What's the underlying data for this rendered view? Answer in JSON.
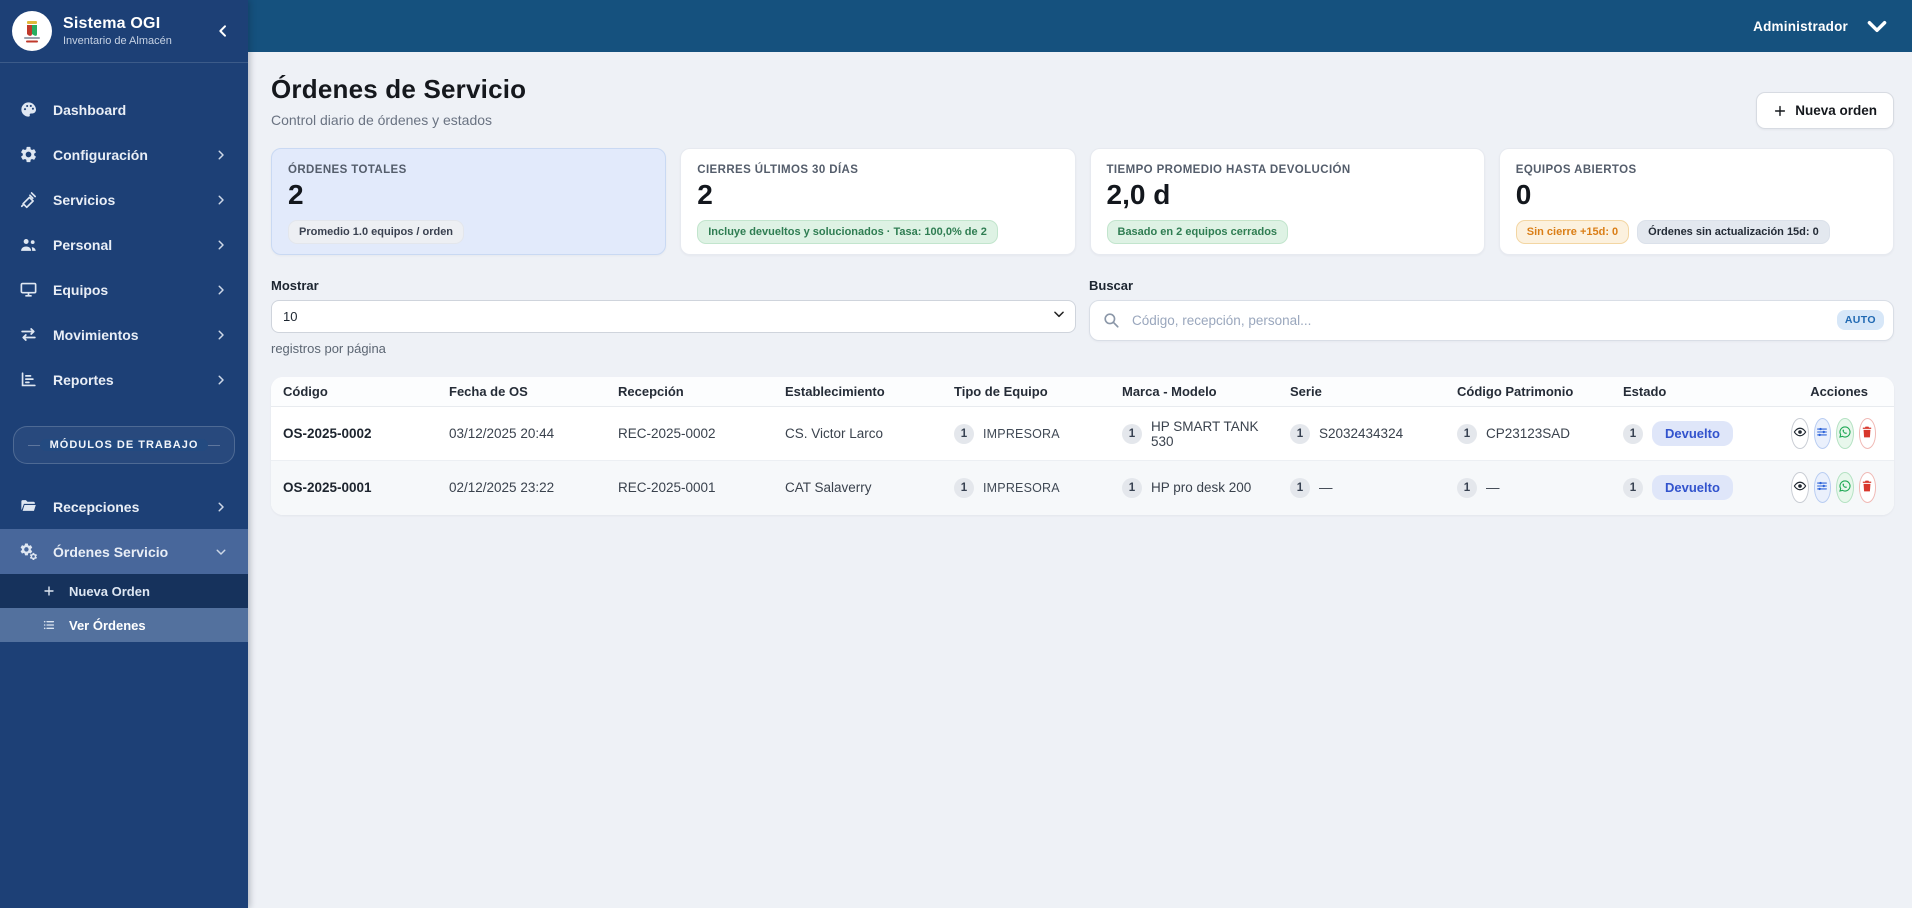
{
  "app": {
    "name": "Sistema OGI",
    "subtitle": "Inventario de Almacén",
    "user": "Administrador",
    "logo": "health-network-emblem"
  },
  "colors": {
    "sidebar": "#1d4076",
    "topbar": "#15517e",
    "active_item": "#48679b",
    "accent_blue": "#3253cd",
    "status_green": "#2f7d52",
    "status_orange": "#da7e16",
    "delete_red": "#d8372c",
    "whatsapp_green": "#1fa855",
    "selected_card": "#e2eafb"
  },
  "sidebar": {
    "items": [
      {
        "label": "Dashboard",
        "icon": "dashboard-icon",
        "chevron": null
      },
      {
        "label": "Configuración",
        "icon": "gear-icon",
        "chevron": "right"
      },
      {
        "label": "Servicios",
        "icon": "syringe-icon",
        "chevron": "right"
      },
      {
        "label": "Personal",
        "icon": "people-icon",
        "chevron": "right"
      },
      {
        "label": "Equipos",
        "icon": "monitor-icon",
        "chevron": "right"
      },
      {
        "label": "Movimientos",
        "icon": "swap-arrows-icon",
        "chevron": "right"
      },
      {
        "label": "Reportes",
        "icon": "report-icon",
        "chevron": "right"
      }
    ],
    "section_label": "MÓDULOS DE TRABAJO",
    "module_items": [
      {
        "label": "Recepciones",
        "icon": "folder-open-icon",
        "chevron": "right",
        "active": false
      },
      {
        "label": "Órdenes Servicio",
        "icon": "gears-icon",
        "chevron": "down",
        "active": true
      }
    ],
    "sub_items": [
      {
        "label": "Nueva Orden",
        "icon": "plus-icon",
        "active": false
      },
      {
        "label": "Ver Órdenes",
        "icon": "list-icon",
        "active": true
      }
    ]
  },
  "page": {
    "title": "Órdenes de Servicio",
    "subtitle": "Control diario de órdenes y estados",
    "new_order_label": "Nueva orden"
  },
  "stats": [
    {
      "label": "ÓRDENES TOTALES",
      "value": "2",
      "selected": true,
      "badges": [
        {
          "text": "Promedio 1.0 equipos / orden",
          "type": "neutral"
        }
      ]
    },
    {
      "label": "CIERRES ÚLTIMOS 30 DÍAS",
      "value": "2",
      "selected": false,
      "badges": [
        {
          "text": "Incluye devueltos y solucionados · Tasa: 100,0% de 2",
          "type": "green"
        }
      ]
    },
    {
      "label": "TIEMPO PROMEDIO HASTA DEVOLUCIÓN",
      "value": "2,0 d",
      "selected": false,
      "badges": [
        {
          "text": "Basado en 2 equipos cerrados",
          "type": "green"
        }
      ]
    },
    {
      "label": "EQUIPOS ABIERTOS",
      "value": "0",
      "selected": false,
      "badges": [
        {
          "text": "Sin cierre +15d: 0",
          "type": "orange"
        },
        {
          "text": "Órdenes sin actualización 15d: 0",
          "type": "gray"
        }
      ]
    }
  ],
  "filters": {
    "show_label": "Mostrar",
    "show_value": "10",
    "show_hint": "registros por página",
    "search_label": "Buscar",
    "search_placeholder": "Código, recepción, personal...",
    "auto_badge": "AUTO"
  },
  "table": {
    "headers": [
      "Código",
      "Fecha de OS",
      "Recepción",
      "Establecimiento",
      "Tipo de Equipo",
      "Marca - Modelo",
      "Serie",
      "Código Patrimonio",
      "Estado",
      "Acciones"
    ],
    "rows": [
      {
        "codigo": "OS-2025-0002",
        "fecha": "03/12/2025 20:44",
        "recepcion": "REC-2025-0002",
        "establecimiento": "CS. Victor Larco",
        "tipo_count": "1",
        "tipo": "IMPRESORA",
        "marca_count": "1",
        "marca": "HP SMART TANK 530",
        "serie_count": "1",
        "serie": "S2032434324",
        "patrimonio_count": "1",
        "patrimonio": "CP23123SAD",
        "estado_count": "1",
        "estado": "Devuelto"
      },
      {
        "codigo": "OS-2025-0001",
        "fecha": "02/12/2025 23:22",
        "recepcion": "REC-2025-0001",
        "establecimiento": "CAT Salaverry",
        "tipo_count": "1",
        "tipo": "IMPRESORA",
        "marca_count": "1",
        "marca": "HP pro desk 200",
        "serie_count": "1",
        "serie": "—",
        "patrimonio_count": "1",
        "patrimonio": "—",
        "estado_count": "1",
        "estado": "Devuelto"
      }
    ],
    "row_actions": [
      {
        "name": "view",
        "icon": "eye-icon"
      },
      {
        "name": "detail",
        "icon": "sliders-icon"
      },
      {
        "name": "whatsapp",
        "icon": "whatsapp-icon"
      },
      {
        "name": "delete",
        "icon": "trash-icon"
      }
    ]
  }
}
